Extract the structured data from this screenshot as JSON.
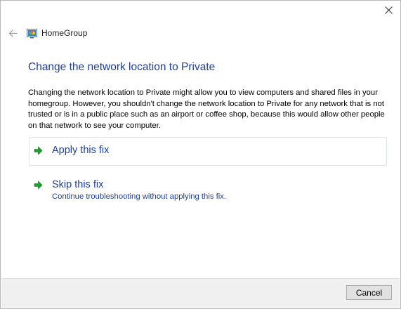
{
  "window": {
    "title": "HomeGroup",
    "icons": {
      "close": "close-icon",
      "back": "back-arrow-icon",
      "app": "homegroup-icon"
    }
  },
  "content": {
    "heading": "Change the network location to Private",
    "description": "Changing the network location to Private might allow you to view computers and shared files in your homegroup. However, you shouldn't change the network location to Private for any network that is not trusted or is in a public place such as an airport or coffee shop, because this would allow other people on that network to see your computer.",
    "options": [
      {
        "label": "Apply this fix",
        "icon": "green-arrow-icon"
      },
      {
        "label": "Skip this fix",
        "sublabel": "Continue troubleshooting without applying this fix.",
        "icon": "green-arrow-icon"
      }
    ]
  },
  "footer": {
    "cancel_label": "Cancel"
  },
  "colors": {
    "heading": "#1e3f9a",
    "arrow": "#1f9e2e",
    "footer_bg": "#f0f0f0"
  }
}
